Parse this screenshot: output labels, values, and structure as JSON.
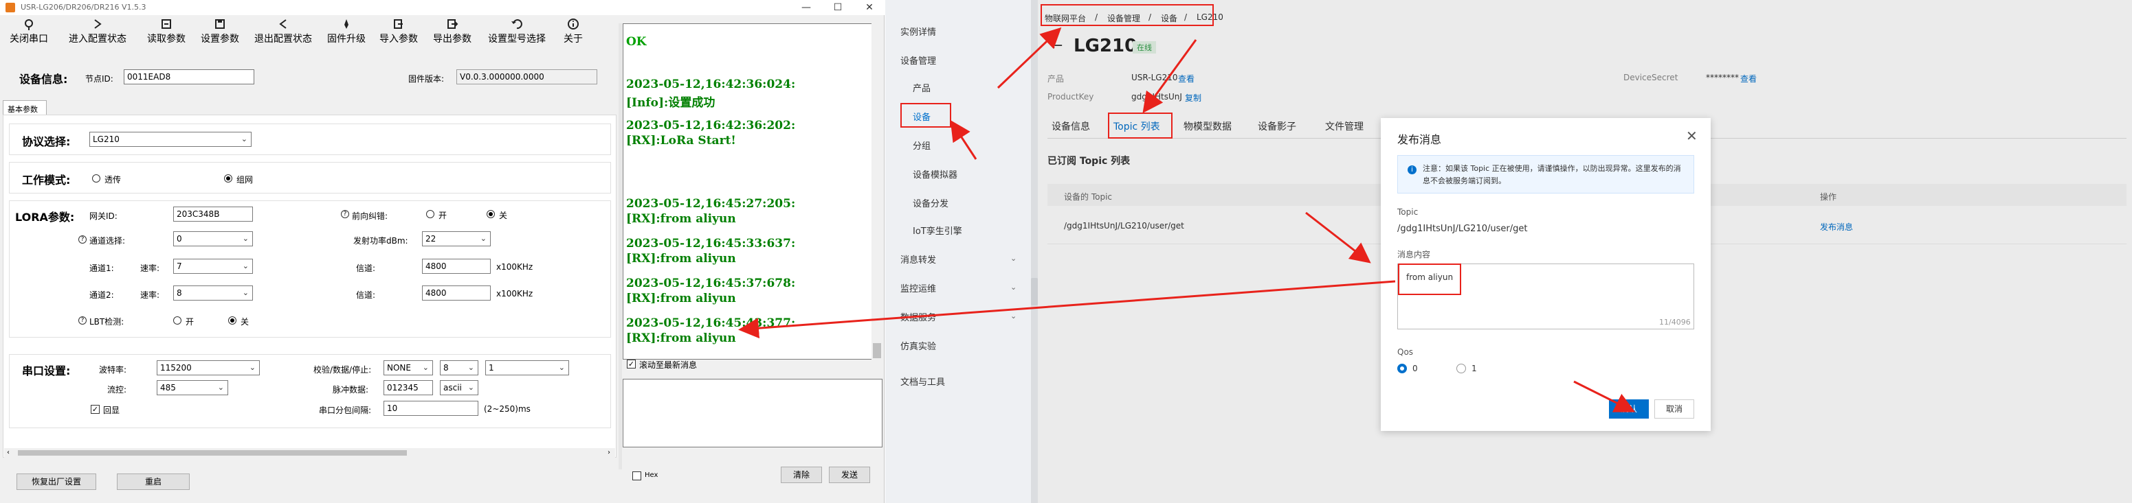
{
  "left_app": {
    "window_title": "USR-LG206/DR206/DR216 V1.5.3",
    "toolbar": [
      {
        "label": "关闭串口",
        "icon": "port-icon"
      },
      {
        "label": "进入配置状态",
        "icon": "arrow-right-icon"
      },
      {
        "label": "读取参数",
        "icon": "read-icon"
      },
      {
        "label": "设置参数",
        "icon": "save-icon"
      },
      {
        "label": "退出配置状态",
        "icon": "arrow-left-icon"
      },
      {
        "label": "固件升级",
        "icon": "rocket-icon"
      },
      {
        "label": "导入参数",
        "icon": "import-icon"
      },
      {
        "label": "导出参数",
        "icon": "export-icon"
      },
      {
        "label": "设置型号选择",
        "icon": "undo-icon"
      },
      {
        "label": "关于",
        "icon": "info-icon"
      }
    ],
    "device_info": {
      "section": "设备信息:",
      "node_id_label": "节点ID:",
      "node_id": "0011EAD8",
      "firmware_label": "固件版本:",
      "firmware": "V0.0.3.000000.0000"
    },
    "tab_basic": "基本参数",
    "protocol": {
      "section": "协议选择:",
      "value": "LG210"
    },
    "work_mode": {
      "section": "工作模式:",
      "opt1": "透传",
      "opt2": "组网"
    },
    "lora": {
      "section": "LORA参数:",
      "gateway_id_label": "网关ID:",
      "gateway_id": "203C348B",
      "forward_error_label": "前向纠错:",
      "on": "开",
      "off": "关",
      "channel_select_label": "通道选择:",
      "channel_select": "0",
      "tx_power_label": "发射功率dBm:",
      "tx_power": "22",
      "channel1_label": "通道1:",
      "rate_label": "速率:",
      "channel1_rate": "7",
      "freq_label": "信道:",
      "channel1_freq": "4800",
      "unit": "x100KHz",
      "channel2_label": "通道2:",
      "channel2_rate": "8",
      "channel2_freq": "4800",
      "lbt_label": "LBT检测:"
    },
    "serial": {
      "section": "串口设置:",
      "baud_label": "波特率:",
      "baud": "115200",
      "parity_label": "校验/数据/停止:",
      "parity": "NONE",
      "data_bits": "8",
      "stop_bits": "1",
      "flow_label": "流控:",
      "flow": "485",
      "heartbeat_label": "脉冲数据:",
      "heartbeat": "012345",
      "heartbeat_fmt": "ascii",
      "echo_label": "回显",
      "pkt_interval_label": "串口分包间隔:",
      "pkt_interval": "10",
      "pkt_interval_range": "(2~250)ms"
    },
    "log": [
      {
        "ts": "OK",
        "msg": ""
      },
      {
        "ts": "2023-05-12,16:42:36:024:",
        "msg": "[Info]:设置成功"
      },
      {
        "ts": "2023-05-12,16:42:36:202:",
        "msg": "[RX]:LoRa Start!"
      },
      {
        "ts": "2023-05-12,16:45:27:205:",
        "msg": "[RX]:from aliyun"
      },
      {
        "ts": "2023-05-12,16:45:33:637:",
        "msg": "[RX]:from aliyun"
      },
      {
        "ts": "2023-05-12,16:45:37:678:",
        "msg": "[RX]:from aliyun"
      },
      {
        "ts": "2023-05-12,16:45:43:377:",
        "msg": "[RX]:from aliyun"
      }
    ],
    "autoscroll_label": "滚动至最新消息",
    "hex_label": "Hex",
    "btn_reset": "恢复出厂设置",
    "btn_restart": "重启",
    "btn_clear": "清除",
    "btn_send": "发送"
  },
  "right_app": {
    "sidebar": [
      {
        "label": "实例详情"
      },
      {
        "label": "设备管理"
      },
      {
        "label": "产品"
      },
      {
        "label": "设备"
      },
      {
        "label": "分组"
      },
      {
        "label": "设备模拟器"
      },
      {
        "label": "设备分发"
      },
      {
        "label": "IoT孪生引擎"
      },
      {
        "label": "消息转发"
      },
      {
        "label": "监控运维"
      },
      {
        "label": "数据服务"
      },
      {
        "label": "仿真实验"
      },
      {
        "label": "文档与工具"
      }
    ],
    "breadcrumb": [
      "物联网平台",
      "/",
      "设备管理",
      "/",
      "设备",
      "/",
      "LG210"
    ],
    "device_title": "LG210",
    "status_badge": "在线",
    "product_label": "产品",
    "product_value": "USR-LG210",
    "view_link": "查看",
    "productkey_label": "ProductKey",
    "productkey_value": "gdg1IHtsUnJ",
    "copy_link": "复制",
    "devicesecret_label": "DeviceSecret",
    "devicesecret_value": "********",
    "tabs": [
      "设备信息",
      "Topic 列表",
      "物模型数据",
      "设备影子",
      "文件管理"
    ],
    "topic_section": "已订阅 Topic 列表",
    "col_topic": "设备的 Topic",
    "col_action": "操作",
    "row_topic": "/gdg1IHtsUnJ/LG210/user/get",
    "row_action": "发布消息",
    "modal": {
      "title": "发布消息",
      "notice": "注意：如果该 Topic 正在被使用，请谨慎操作，以防出现异常。这里发布的消息不会被服务端订阅到。",
      "topic_label": "Topic",
      "topic_value": "/gdg1IHtsUnJ/LG210/user/get",
      "content_label": "消息内容",
      "content_value": "from aliyun",
      "char_count": "11/4096",
      "qos_label": "Qos",
      "qos0": "0",
      "qos1": "1",
      "confirm": "确认",
      "cancel": "取消"
    }
  },
  "colors": {
    "red": "#e8221b",
    "blue": "#0070cc",
    "log_green": "#008000"
  }
}
